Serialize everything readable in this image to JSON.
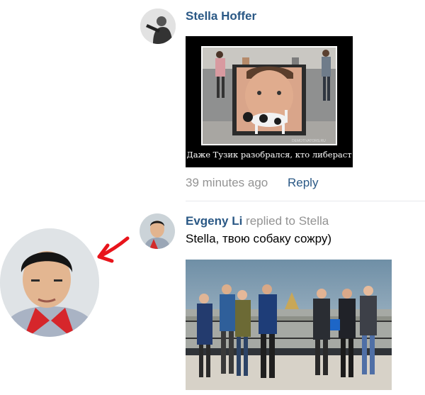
{
  "comment1": {
    "author": "Stella Hoffer",
    "meme_caption": "Даже Тузик разобрался, кто либераст",
    "watermark": "DEMOTIVATORS.RU",
    "time": "39 minutes ago",
    "reply_label": "Reply"
  },
  "comment2": {
    "author": "Evgeny Li",
    "replied_to": "replied to Stella",
    "text": "Stella, твою собаку сожру)"
  },
  "colors": {
    "link": "#2a5885",
    "meta": "#939393",
    "arrow": "#e8141b",
    "divider": "#e7e8ec"
  }
}
